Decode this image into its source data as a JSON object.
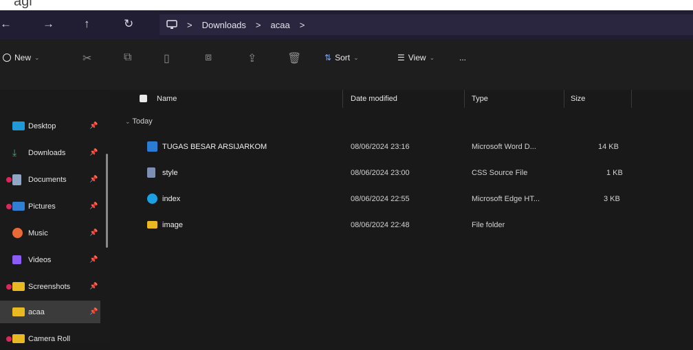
{
  "caption": {
    "text": "agi"
  },
  "nav": {
    "back": "←",
    "forward": "→",
    "up": "↑",
    "refresh": "↻",
    "breadcrumbs": [
      "Downloads",
      "acaa"
    ],
    "separator": ">"
  },
  "toolbar": {
    "new_label": "New",
    "sort_label": "Sort",
    "view_label": "View",
    "more_label": "..."
  },
  "sidebar": {
    "items": [
      {
        "label": "Desktop",
        "icon": "desktop-icon",
        "color": "#1f9ad9"
      },
      {
        "label": "Downloads",
        "icon": "download-icon",
        "color": "#3cb371"
      },
      {
        "label": "Documents",
        "icon": "document-icon",
        "color": "#8fa7c4"
      },
      {
        "label": "Pictures",
        "icon": "pictures-icon",
        "color": "#2f7fd3"
      },
      {
        "label": "Music",
        "icon": "music-icon",
        "color": "#e86a36"
      },
      {
        "label": "Videos",
        "icon": "video-icon",
        "color": "#8b5cf6"
      },
      {
        "label": "Screenshots",
        "icon": "folder-icon",
        "color": "#e8b923"
      },
      {
        "label": "acaa",
        "icon": "folder-icon",
        "color": "#e8b923"
      },
      {
        "label": "Camera Roll",
        "icon": "folder-icon",
        "color": "#e8b923"
      }
    ]
  },
  "columns": {
    "name": "Name",
    "date": "Date modified",
    "type": "Type",
    "size": "Size"
  },
  "group": {
    "label": "Today"
  },
  "files": [
    {
      "name": "TUGAS BESAR ARSIJARKOM",
      "date": "08/06/2024 23:16",
      "type": "Microsoft Word D...",
      "size": "14 KB",
      "icon": "word-icon",
      "color": "#2b7cd3"
    },
    {
      "name": "style",
      "date": "08/06/2024 23:00",
      "type": "CSS Source File",
      "size": "1 KB",
      "icon": "css-file-icon",
      "color": "#7d8fb3"
    },
    {
      "name": "index",
      "date": "08/06/2024 22:55",
      "type": "Microsoft Edge HT...",
      "size": "3 KB",
      "icon": "edge-icon",
      "color": "#1ba0e2"
    },
    {
      "name": "image",
      "date": "08/06/2024 22:48",
      "type": "File folder",
      "size": "",
      "icon": "folder-icon",
      "color": "#e8b923"
    }
  ]
}
